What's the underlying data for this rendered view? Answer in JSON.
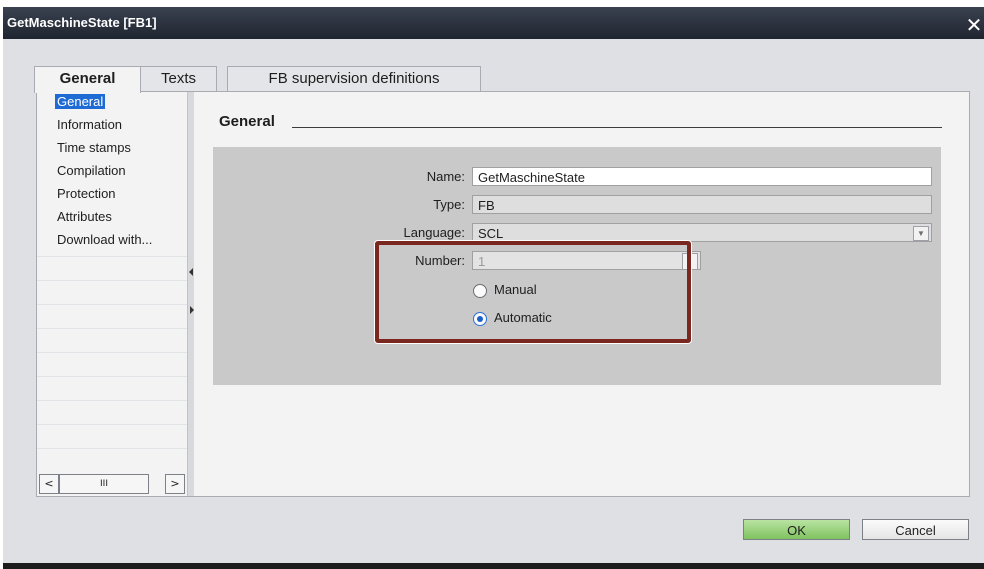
{
  "dialog": {
    "title": "GetMaschineState [FB1]",
    "close_glyph": "✕"
  },
  "tabs": [
    {
      "label": "General",
      "active": true
    },
    {
      "label": "Texts",
      "active": false
    },
    {
      "label": "FB supervision definitions",
      "active": false
    }
  ],
  "nav": {
    "items": [
      {
        "label": "General",
        "selected": true
      },
      {
        "label": "Information",
        "selected": false
      },
      {
        "label": "Time stamps",
        "selected": false
      },
      {
        "label": "Compilation",
        "selected": false
      },
      {
        "label": "Protection",
        "selected": false
      },
      {
        "label": "Attributes",
        "selected": false
      },
      {
        "label": "Download with...",
        "selected": false
      }
    ],
    "scroll_left": "<",
    "scroll_thumb": "III",
    "scroll_right": ">"
  },
  "section": {
    "title": "General"
  },
  "form": {
    "name_label": "Name:",
    "name_value": "GetMaschineState",
    "type_label": "Type:",
    "type_value": "FB",
    "language_label": "Language:",
    "language_value": "SCL",
    "number_label": "Number:",
    "number_value": "1",
    "number_enabled": false,
    "radio_manual": "Manual",
    "radio_automatic": "Automatic",
    "selected_mode": "Automatic"
  },
  "buttons": {
    "ok": "OK",
    "cancel": "Cancel"
  },
  "colors": {
    "highlight_border": "#7a2720",
    "ok_button": "#8fcb6f",
    "selection": "#1e6bd6"
  }
}
